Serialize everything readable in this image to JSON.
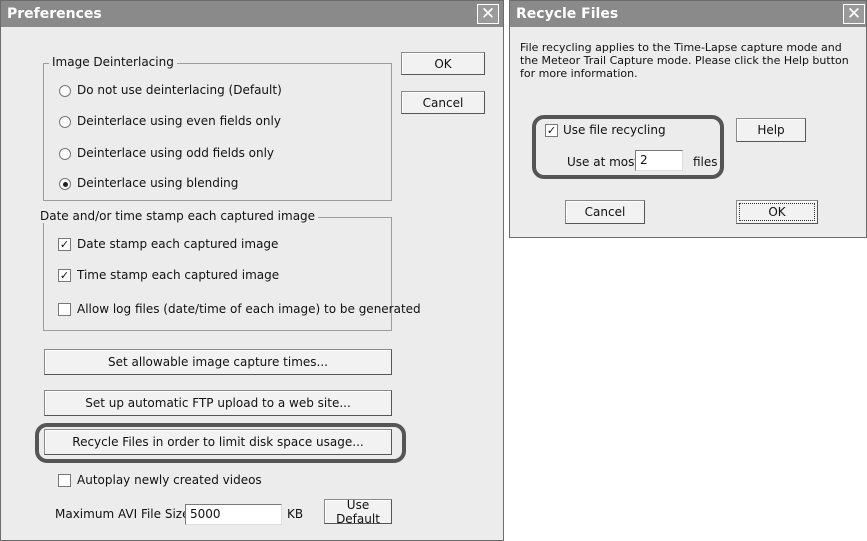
{
  "preferences": {
    "title": "Preferences",
    "ok_label": "OK",
    "cancel_label": "Cancel",
    "deinterlace": {
      "legend": "Image Deinterlacing",
      "options": [
        {
          "label": "Do not use deinterlacing (Default)",
          "selected": false
        },
        {
          "label": "Deinterlace using even fields only",
          "selected": false
        },
        {
          "label": "Deinterlace using odd fields only",
          "selected": false
        },
        {
          "label": "Deinterlace using blending",
          "selected": true
        }
      ]
    },
    "stamp": {
      "legend": "Date and/or time stamp each captured image",
      "options": [
        {
          "label": "Date stamp each captured image",
          "checked": true
        },
        {
          "label": "Time stamp each captured image",
          "checked": true
        },
        {
          "label": "Allow log files (date/time of each image) to be generated",
          "checked": false
        }
      ]
    },
    "capture_times_label": "Set allowable image capture times...",
    "ftp_label": "Set up automatic FTP upload to a web site...",
    "recycle_label": "Recycle Files in order to limit disk space usage...",
    "autoplay": {
      "label": "Autoplay newly created videos",
      "checked": false
    },
    "max_avi": {
      "label": "Maximum AVI File Size:",
      "value": "5000",
      "unit": "KB",
      "default_label": "Use Default"
    }
  },
  "recycle": {
    "title": "Recycle Files",
    "description": "File recycling applies to the Time-Lapse capture mode and the Meteor Trail Capture mode.  Please click the Help button for more information.",
    "use_recycling": {
      "label": "Use file recycling",
      "checked": true
    },
    "use_at_most_label": "Use at most",
    "count_value": "2",
    "files_label": "files",
    "help_label": "Help",
    "cancel_label": "Cancel",
    "ok_label": "OK"
  },
  "icons": {
    "close": "close-icon",
    "check": "check-icon",
    "radio_dot": "radio-dot-icon"
  },
  "colors": {
    "titlebar": "#8a8a8a",
    "window_bg": "#ececec",
    "highlight": "#555555"
  }
}
